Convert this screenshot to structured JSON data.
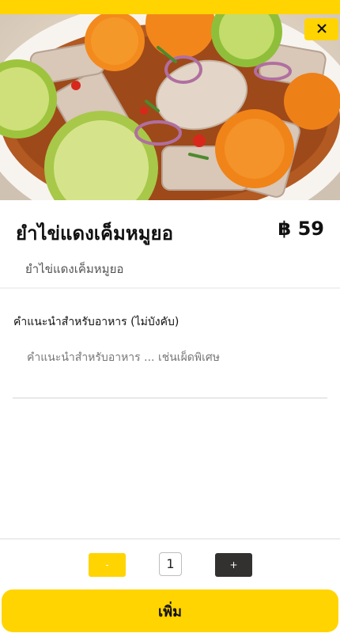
{
  "item": {
    "name": "ยำไข่แดงเค็มหมูยอ",
    "price": "฿ 59",
    "description": "ยำไข่แดงเค็มหมูยอ"
  },
  "notes": {
    "label": "คำแนะนำสำหรับอาหาร (ไม่บังคับ)",
    "placeholder": "คำแนะนำสำหรับอาหาร ... เช่นเผ็ดพิเศษ"
  },
  "quantity": {
    "minus_label": "-",
    "value": "1",
    "plus_label": "+"
  },
  "add_button_label": "เพิ่ม",
  "icons": {
    "close": "close-icon"
  },
  "colors": {
    "accent": "#ffd400",
    "dark_button": "#333130"
  }
}
